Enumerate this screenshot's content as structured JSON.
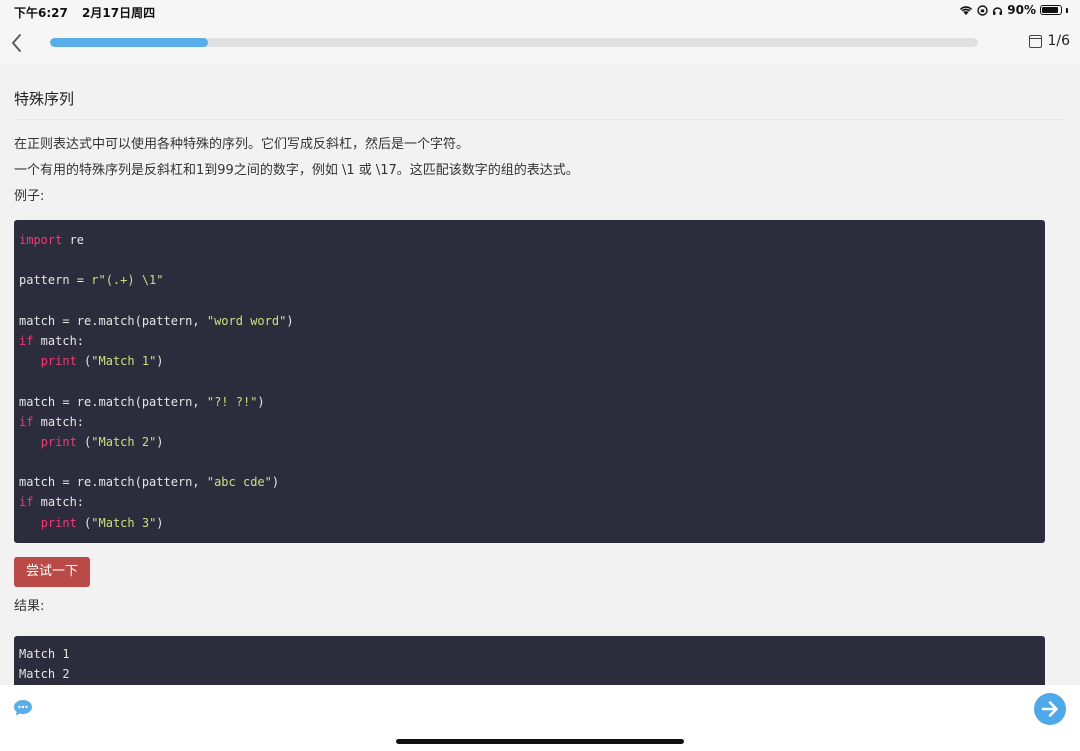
{
  "status_bar": {
    "time": "下午6:27",
    "date": "2月17日周四",
    "battery_percent": "90%",
    "battery_level": 0.9
  },
  "nav": {
    "progress": 0.17,
    "page_indicator": "1/6"
  },
  "lesson": {
    "title": "特殊序列",
    "paragraphs": [
      "在正则表达式中可以使用各种特殊的序列。它们写成反斜杠，然后是一个字符。",
      "一个有用的特殊序列是反斜杠和1到99之间的数字，例如 \\1 或 \\17。这匹配该数字的组的表达式。",
      "例子:"
    ],
    "code": {
      "import_kw": "import",
      "import_mod": " re",
      "pattern_assign": "pattern = ",
      "pattern_value": "r\"(.+) \\1\"",
      "match1_pre": "match = re.match(pattern, ",
      "match1_str": "\"word word\"",
      "match2_str": "\"?! ?!\"",
      "match3_str": "\"abc cde\"",
      "close_paren": ")",
      "if_kw": "if",
      "if_rest": " match:",
      "indent": "   ",
      "print_kw": "print",
      "print_open": " (",
      "print1_str": "\"Match 1\"",
      "print2_str": "\"Match 2\"",
      "print3_str": "\"Match 3\""
    },
    "try_button": "尝试一下",
    "result_label": "结果:",
    "result_lines": [
      "Match 1",
      "Match 2"
    ]
  },
  "colors": {
    "code_bg": "#2b2d3c",
    "keyword": "#f0397a",
    "string": "#c9e07f",
    "accent": "#5aaee8",
    "button": "#b94a48"
  }
}
